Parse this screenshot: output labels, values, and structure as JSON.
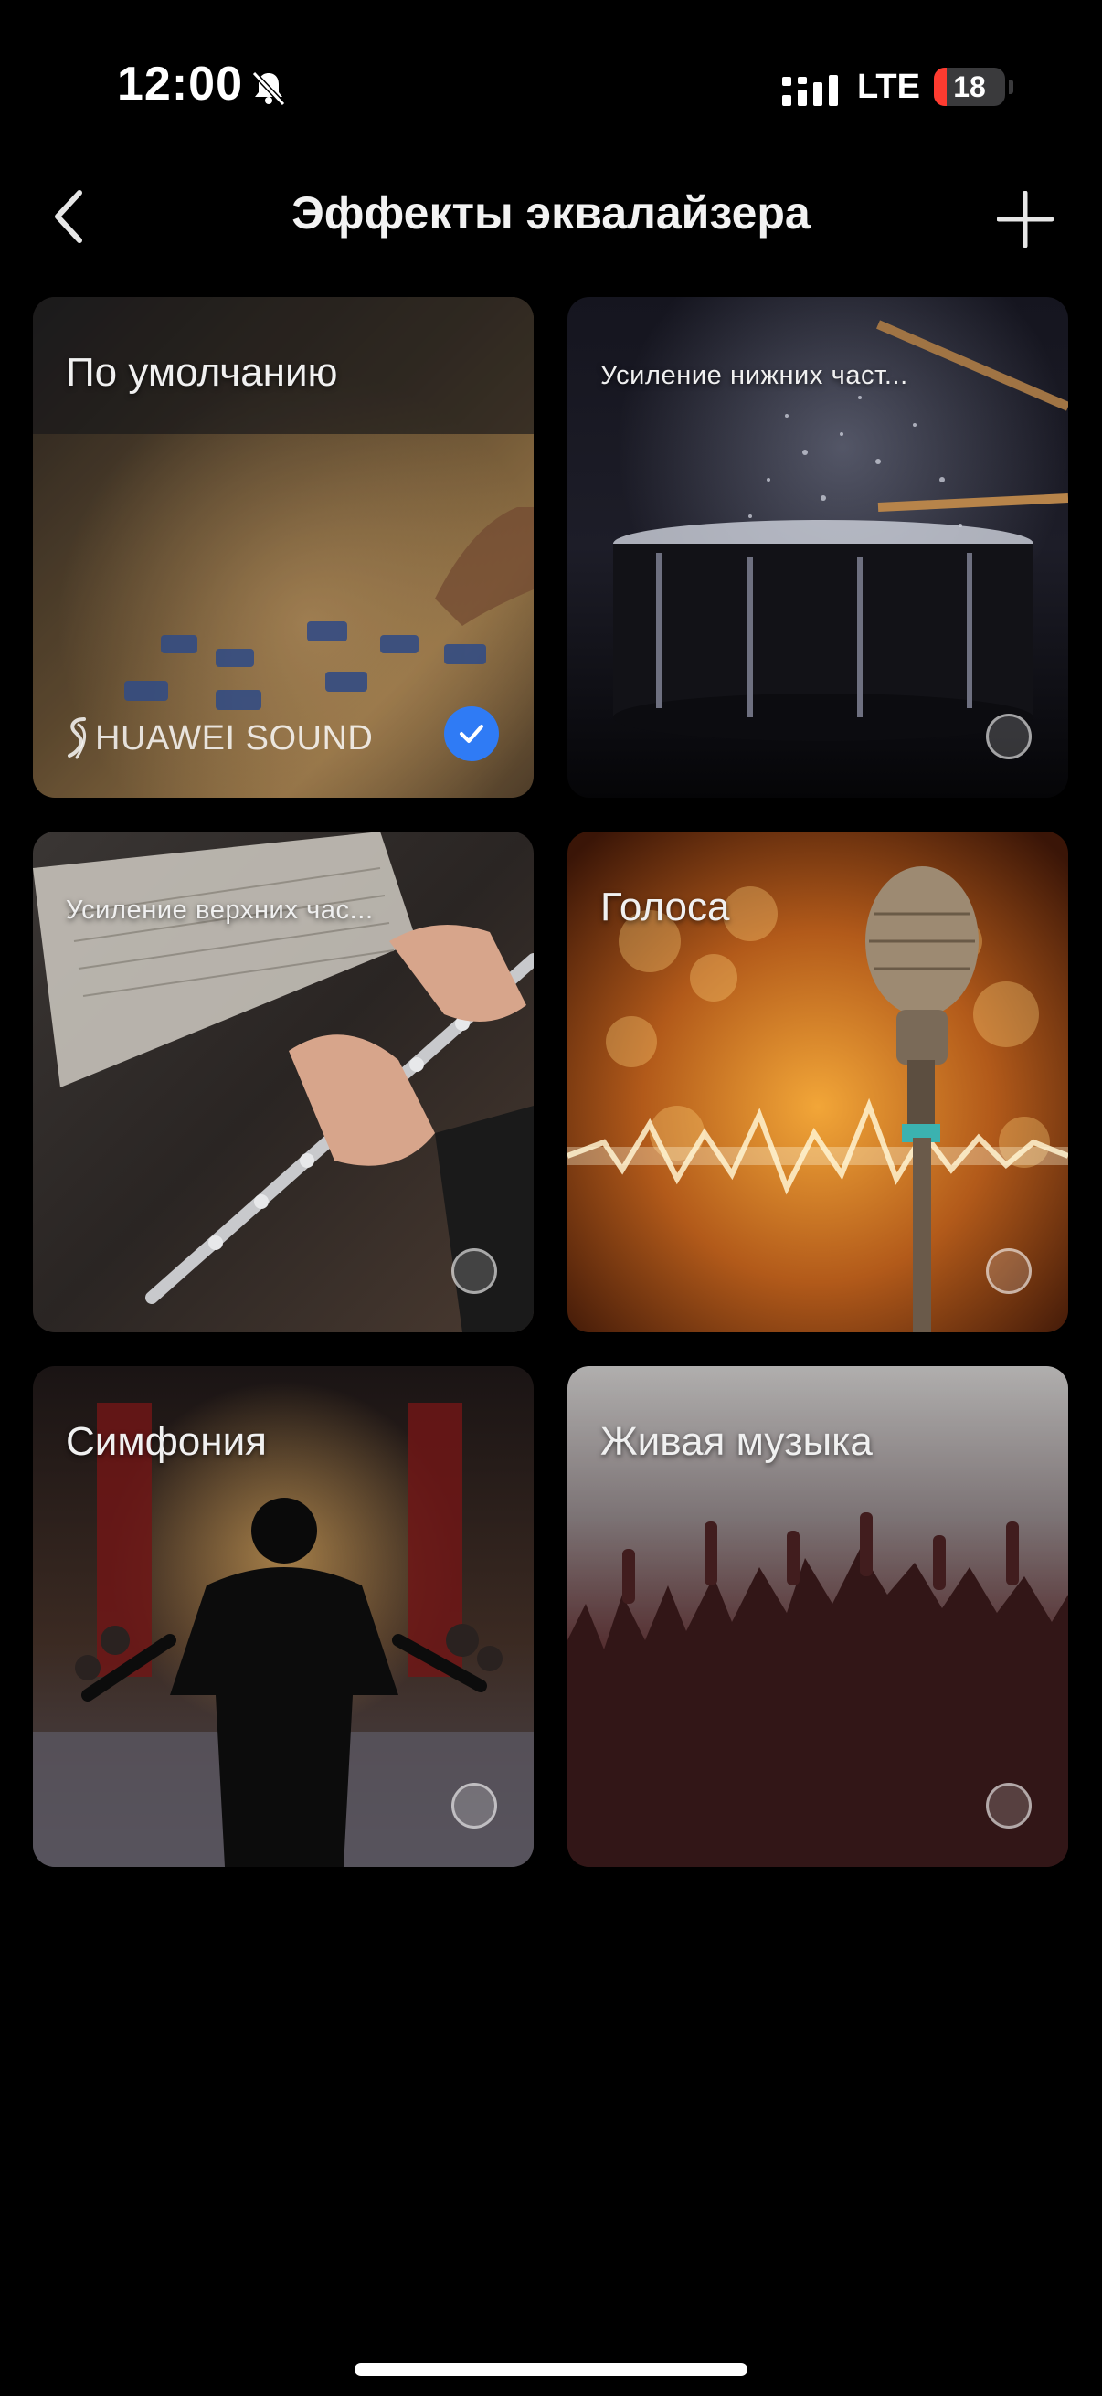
{
  "status_bar": {
    "time": "12:00",
    "network": "LTE",
    "battery_level": "18",
    "battery_color": "#ff3b30"
  },
  "header": {
    "title": "Эффекты эквалайзера",
    "back_icon": "chevron-left-icon",
    "add_icon": "plus-icon"
  },
  "presets": [
    {
      "label": "По умолчанию",
      "selected": true,
      "brand": "HUAWEI SOUND"
    },
    {
      "label": "Усиление нижних част...",
      "selected": false
    },
    {
      "label": "Усиление верхних час...",
      "selected": false
    },
    {
      "label": "Голоса",
      "selected": false
    },
    {
      "label": "Симфония",
      "selected": false
    },
    {
      "label": "Живая музыка",
      "selected": false
    }
  ],
  "accent_color": "#2f7bf5"
}
